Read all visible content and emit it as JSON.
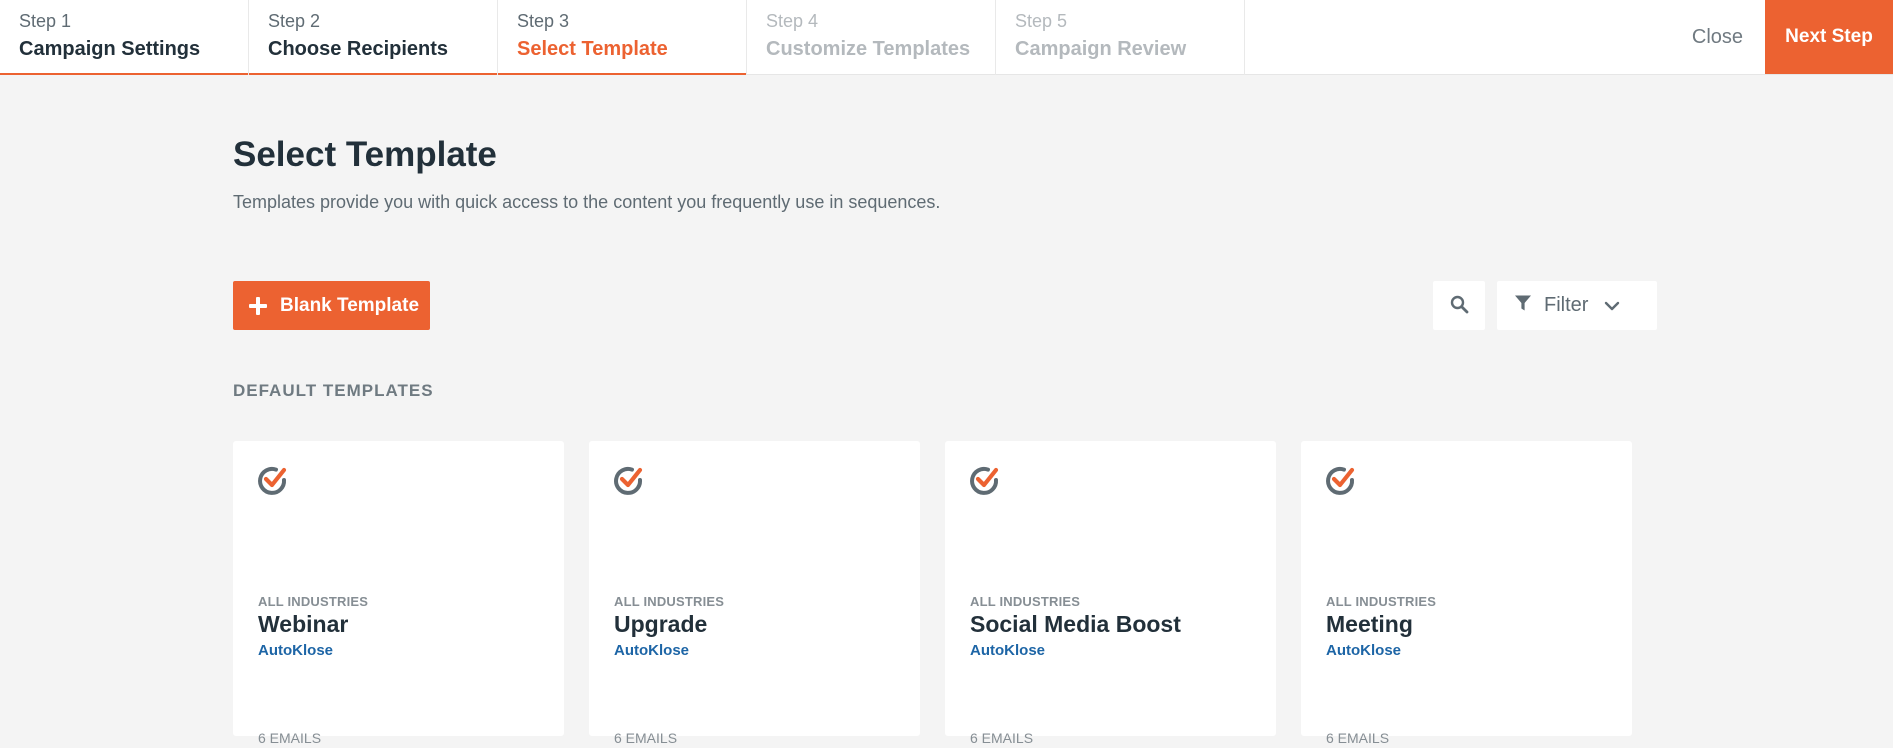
{
  "stepper": {
    "steps": [
      {
        "number": "Step 1",
        "title": "Campaign Settings",
        "state": "done"
      },
      {
        "number": "Step 2",
        "title": "Choose Recipients",
        "state": "done"
      },
      {
        "number": "Step 3",
        "title": "Select Template",
        "state": "active"
      },
      {
        "number": "Step 4",
        "title": "Customize Templates",
        "state": "upcoming"
      },
      {
        "number": "Step 5",
        "title": "Campaign Review",
        "state": "upcoming"
      }
    ],
    "close_label": "Close",
    "next_label": "Next Step"
  },
  "header": {
    "title": "Select Template",
    "description": "Templates provide you with quick access to the content you frequently use in sequences."
  },
  "toolbar": {
    "blank_template_label": "Blank Template",
    "filter_label": "Filter",
    "icons": [
      "plus-icon",
      "search-icon",
      "filter-icon",
      "chevron-down-icon"
    ]
  },
  "section": {
    "label": "DEFAULT TEMPLATES"
  },
  "cards": [
    {
      "industry": "ALL INDUSTRIES",
      "title": "Webinar",
      "author": "AutoKlose",
      "count": "6 EMAILS"
    },
    {
      "industry": "ALL INDUSTRIES",
      "title": "Upgrade",
      "author": "AutoKlose",
      "count": "6 EMAILS"
    },
    {
      "industry": "ALL INDUSTRIES",
      "title": "Social Media Boost",
      "author": "AutoKlose",
      "count": "6 EMAILS"
    },
    {
      "industry": "ALL INDUSTRIES",
      "title": "Meeting",
      "author": "AutoKlose",
      "count": "6 EMAILS"
    }
  ],
  "colors": {
    "accent": "#ec6231",
    "link": "#1d65a6",
    "heading": "#22303a",
    "background": "#f4f4f4"
  }
}
